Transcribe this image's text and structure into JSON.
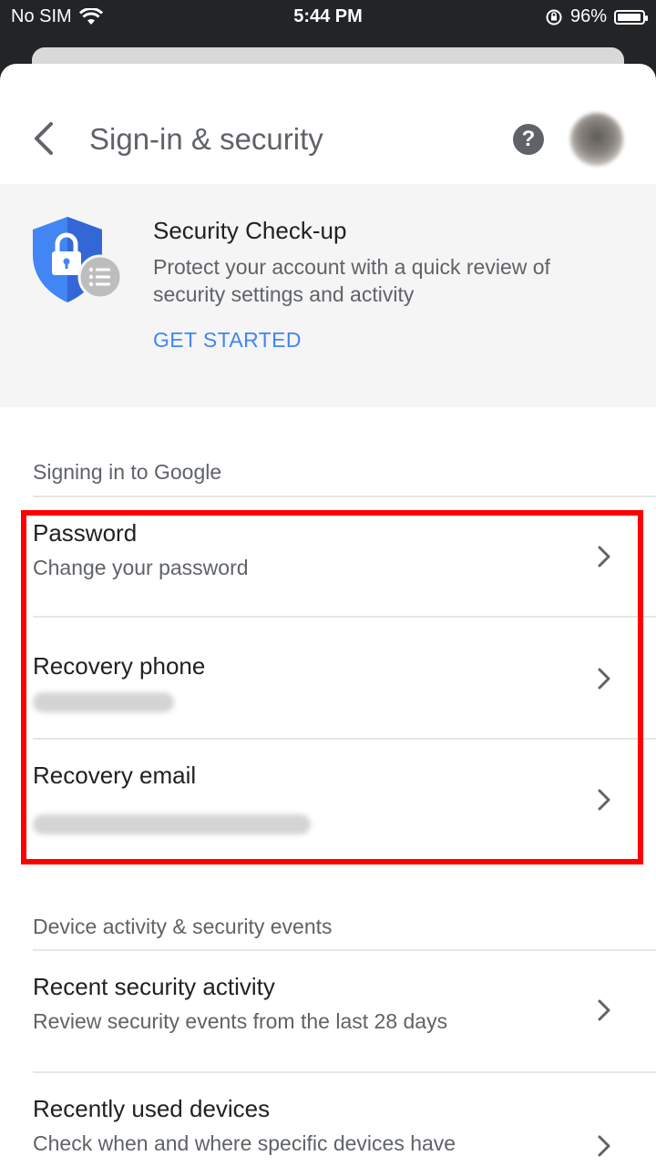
{
  "status_bar": {
    "carrier": "No SIM",
    "time": "5:44 PM",
    "battery": "96%"
  },
  "header": {
    "title": "Sign-in & security",
    "help": "?"
  },
  "security_checkup": {
    "title": "Security Check-up",
    "description": "Protect your account with a quick review of security settings and activity",
    "action": "GET STARTED",
    "accent_color": "#4285f4"
  },
  "sections": [
    {
      "header": "Signing in to Google",
      "items": [
        {
          "title": "Password",
          "subtitle": "Change your password"
        },
        {
          "title": "Recovery phone",
          "subtitle": ""
        },
        {
          "title": "Recovery email",
          "subtitle": ""
        }
      ]
    },
    {
      "header": "Device activity & security events",
      "items": [
        {
          "title": "Recent security activity",
          "subtitle": "Review security events from the last 28 days"
        },
        {
          "title": "Recently used devices",
          "subtitle": "Check when and where specific devices have"
        }
      ]
    }
  ],
  "highlight_color": "#ff0000"
}
